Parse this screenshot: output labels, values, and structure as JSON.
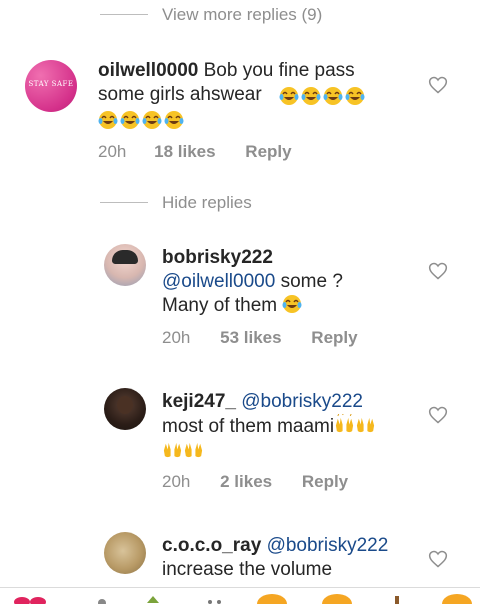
{
  "view_more": "View more replies (9)",
  "hide": "Hide replies",
  "c1": {
    "avatar_text": "STAY SAFE",
    "username": "oilwell0000",
    "text": "Bob you fine pass some girls ahswear",
    "time": "20h",
    "likes": "18 likes",
    "reply": "Reply"
  },
  "c2": {
    "username": "bobrisky222",
    "mention": "@oilwell0000",
    "text_a": "some ?",
    "text_b": "Many of them",
    "time": "20h",
    "likes": "53 likes",
    "reply": "Reply"
  },
  "c3": {
    "username": "keji247_",
    "mention": "@bobrisky222",
    "text": "most of them maami",
    "time": "20h",
    "likes": "2 likes",
    "reply": "Reply"
  },
  "c4": {
    "username": "c.o.c.o_ray",
    "mention": "@bobrisky222",
    "text": "increase the volume"
  },
  "colors": {
    "mention": "#1a4a8a",
    "meta": "#8e8e8e",
    "text": "#262626"
  },
  "icons": [
    "heart-outline-icon",
    "laughing-tears-emoji",
    "raised-hands-emoji"
  ]
}
